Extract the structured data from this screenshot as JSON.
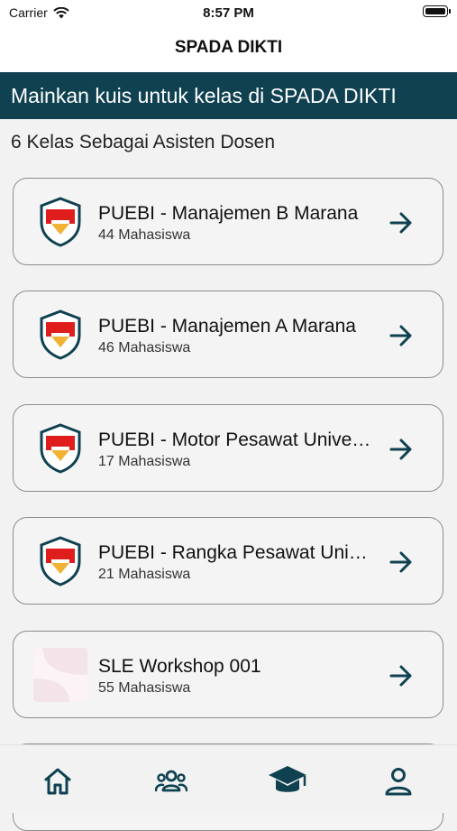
{
  "status_bar": {
    "carrier": "Carrier",
    "time": "8:57 PM"
  },
  "nav": {
    "title": "SPADA DIKTI"
  },
  "banner": {
    "text": "Mainkan kuis untuk kelas di SPADA DIKTI"
  },
  "section": {
    "title": "6 Kelas Sebagai Asisten Dosen"
  },
  "colors": {
    "accent": "#0f4151",
    "card_border": "#8d8d8d",
    "background": "#f2f2f2"
  },
  "classes": [
    {
      "title": "PUEBI - Manajemen B Marana",
      "students": "44 Mahasiswa",
      "icon": "puebi-logo-icon"
    },
    {
      "title": "PUEBI - Manajemen A Marana",
      "students": "46 Mahasiswa",
      "icon": "puebi-logo-icon"
    },
    {
      "title": "PUEBI - Motor Pesawat Universitas",
      "students": "17 Mahasiswa",
      "icon": "puebi-logo-icon"
    },
    {
      "title": "PUEBI - Rangka Pesawat Universitas",
      "students": "21 Mahasiswa",
      "icon": "puebi-logo-icon"
    },
    {
      "title": "SLE Workshop 001",
      "students": "55 Mahasiswa",
      "icon": "class-thumbnail"
    }
  ],
  "tabs": [
    {
      "icon": "home-icon"
    },
    {
      "icon": "group-icon"
    },
    {
      "icon": "graduation-cap-icon",
      "selected": true
    },
    {
      "icon": "profile-icon"
    }
  ]
}
